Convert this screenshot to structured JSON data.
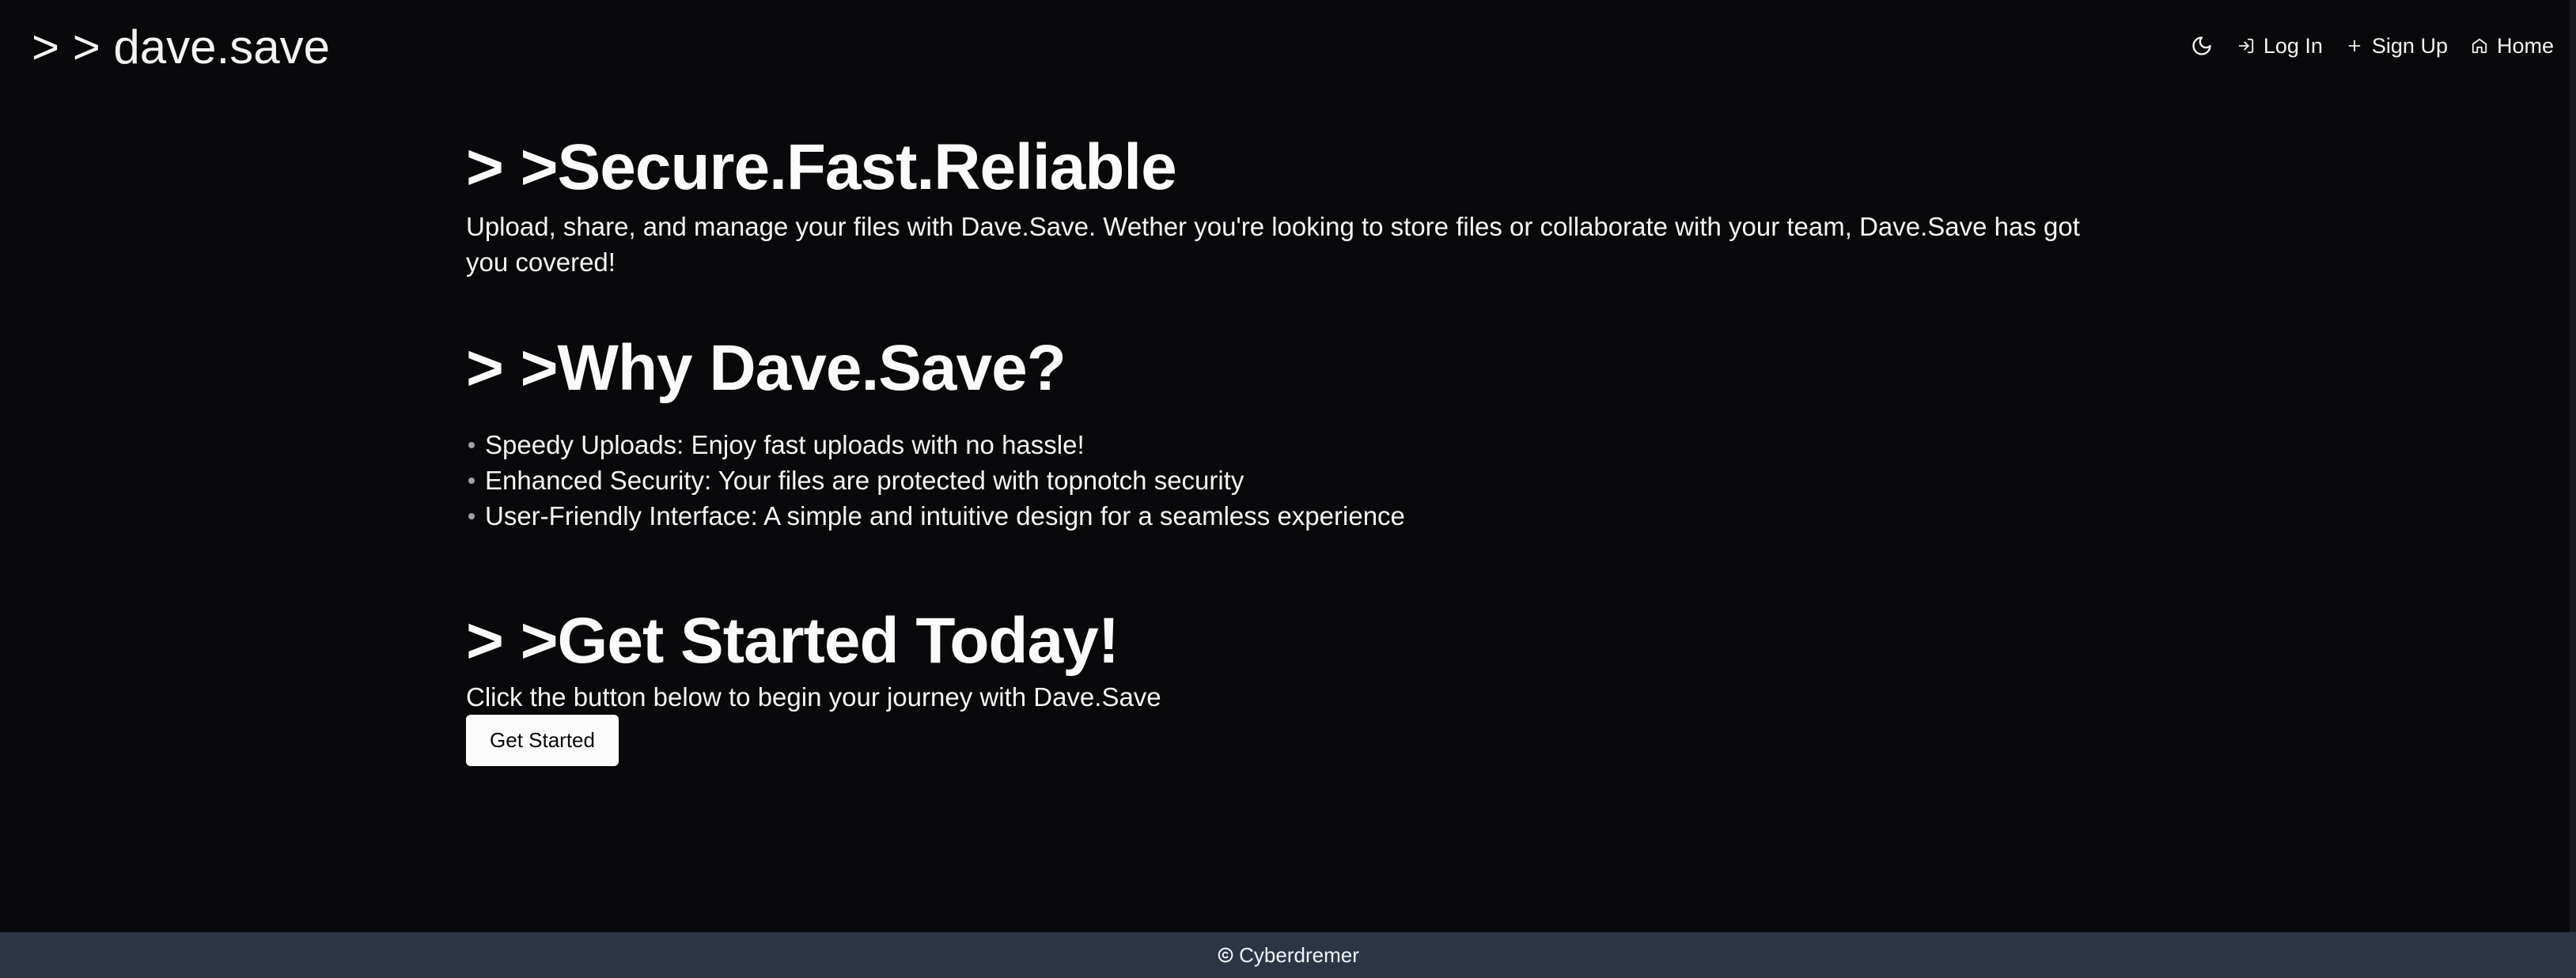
{
  "header": {
    "logo": "> > dave.save",
    "nav": {
      "theme_icon": "moon-icon",
      "login_icon": "log-in-icon",
      "login_label": "Log In",
      "signup_icon": "plus-icon",
      "signup_label": "Sign Up",
      "home_icon": "home-icon",
      "home_label": "Home"
    }
  },
  "hero": {
    "title": "> >Secure.Fast.Reliable",
    "text": "Upload, share, and manage your files with Dave.Save. Wether you're looking to store files or collaborate with your team, Dave.Save has got you covered!"
  },
  "why": {
    "title": "> >Why Dave.Save?",
    "items": [
      "Speedy Uploads: Enjoy fast uploads with no hassle!",
      "Enhanced Security: Your files are protected with topnotch security",
      "User-Friendly Interface: A simple and intuitive design for a seamless experience"
    ]
  },
  "cta": {
    "title": "> >Get Started Today!",
    "text": "Click the button below to begin your journey with Dave.Save",
    "button_label": "Get Started"
  },
  "footer": {
    "icon": "copyright-icon",
    "text": "Cyberdremer"
  },
  "colors": {
    "background": "#09090b",
    "text": "#fafafa",
    "footer_bg": "#2c3544",
    "button_bg": "#fafafa",
    "button_text": "#09090b"
  }
}
